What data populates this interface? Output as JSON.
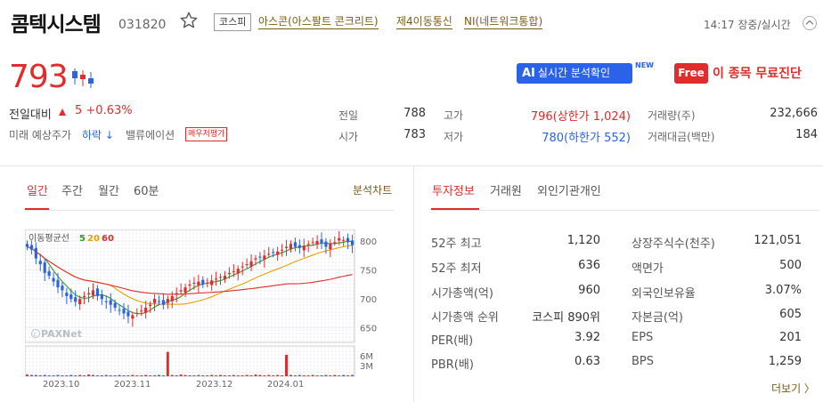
{
  "header": {
    "name": "콤텍시스템",
    "code": "031820",
    "market": "코스피",
    "tags": [
      "아스콘(아스팔트 콘크리트)",
      "제4이동통신",
      "NI(네트워크통합)"
    ],
    "time_status": "14:17 장중/실시간"
  },
  "price": {
    "current": "793",
    "change_label": "전일대비",
    "change_value": "5 +0.63%",
    "forecast_label": "미래 예상주가",
    "forecast_value": "하락 ↓",
    "valuation_label": "밸류에이션",
    "valuation_button": "매우저평가"
  },
  "buttons": {
    "ai_prefix": "AI",
    "ai_label": "실시간 분석확인",
    "new_tag": "NEW",
    "free": "Free",
    "free_label": "이 종목 무료진단"
  },
  "quote": {
    "prev_label": "전일",
    "prev_value": "788",
    "open_label": "시가",
    "open_value": "783",
    "high_label": "고가",
    "high_value": "796(상한가 1,024)",
    "low_label": "저가",
    "low_value": "780(하한가 552)",
    "volume_label": "거래량(주)",
    "volume_value": "232,666",
    "amount_label": "거래대금(백만)",
    "amount_value": "184"
  },
  "chart_tabs": {
    "items": [
      "일간",
      "주간",
      "월간",
      "60분"
    ],
    "analysis_link": "분석차트"
  },
  "info_tabs": {
    "items": [
      "투자정보",
      "거래원",
      "외인기관개인"
    ]
  },
  "chart_data": {
    "type": "candlestick",
    "legend_title": "이동평균선",
    "ma_labels": [
      "5",
      "20",
      "60"
    ],
    "ma_colors": [
      "#2e9a2e",
      "#e8a000",
      "#e02c2c"
    ],
    "y_ticks": [
      "800",
      "750",
      "700",
      "650"
    ],
    "y_tick_values": [
      800,
      750,
      700,
      650
    ],
    "y_range": [
      625,
      820
    ],
    "volume_ticks": [
      "6M",
      "3M"
    ],
    "x_ticks": [
      "2023.10",
      "2023.11",
      "2023.12",
      "2024.01"
    ],
    "watermark": "PAXNet",
    "close": [
      790,
      785,
      770,
      760,
      745,
      740,
      730,
      720,
      715,
      705,
      700,
      695,
      700,
      705,
      710,
      715,
      705,
      700,
      695,
      690,
      685,
      680,
      675,
      670,
      672,
      676,
      680,
      685,
      690,
      700,
      695,
      690,
      700,
      705,
      710,
      715,
      720,
      725,
      728,
      730,
      725,
      728,
      732,
      735,
      738,
      740,
      745,
      748,
      752,
      756,
      760,
      765,
      770,
      772,
      775,
      778,
      780,
      782,
      785,
      790,
      795,
      790,
      788,
      792,
      795,
      798,
      800,
      796,
      790,
      795,
      798,
      805,
      802,
      798,
      793
    ],
    "volume": [
      0.4,
      0.3,
      0.3,
      0.2,
      0.3,
      0.2,
      0.2,
      0.3,
      0.2,
      0.2,
      0.3,
      0.2,
      0.3,
      0.2,
      0.4,
      0.3,
      0.2,
      0.2,
      0.3,
      0.2,
      0.2,
      0.3,
      0.2,
      0.2,
      0.3,
      0.2,
      0.2,
      0.3,
      0.2,
      0.2,
      0.3,
      0.2,
      5.8,
      0.3,
      0.2,
      0.4,
      0.3,
      0.2,
      0.2,
      0.3,
      0.2,
      0.2,
      0.3,
      0.2,
      0.3,
      0.2,
      0.2,
      0.3,
      0.2,
      0.2,
      0.3,
      0.2,
      0.4,
      0.3,
      0.2,
      0.3,
      0.2,
      0.3,
      0.2,
      5.1,
      0.3,
      0.2,
      0.3,
      0.2,
      0.2,
      0.3,
      0.2,
      0.2,
      0.3,
      0.2,
      0.3,
      0.2,
      0.3,
      0.2,
      0.3
    ]
  },
  "investment_info": {
    "left": [
      {
        "label": "52주 최고",
        "value": "1,120"
      },
      {
        "label": "52주 최저",
        "value": "636"
      },
      {
        "label": "시가총액(억)",
        "value": "960"
      },
      {
        "label": "시가총액 순위",
        "value": "코스피 890위"
      },
      {
        "label": "PER(배)",
        "value": "3.92"
      },
      {
        "label": "PBR(배)",
        "value": "0.63"
      }
    ],
    "right": [
      {
        "label": "상장주식수(천주)",
        "value": "121,051"
      },
      {
        "label": "액면가",
        "value": "500"
      },
      {
        "label": "외국인보유율",
        "value": "3.07%"
      },
      {
        "label": "자본금(억)",
        "value": "605"
      },
      {
        "label": "EPS",
        "value": "201"
      },
      {
        "label": "BPS",
        "value": "1,259"
      }
    ],
    "more_link": "더보기 〉"
  }
}
